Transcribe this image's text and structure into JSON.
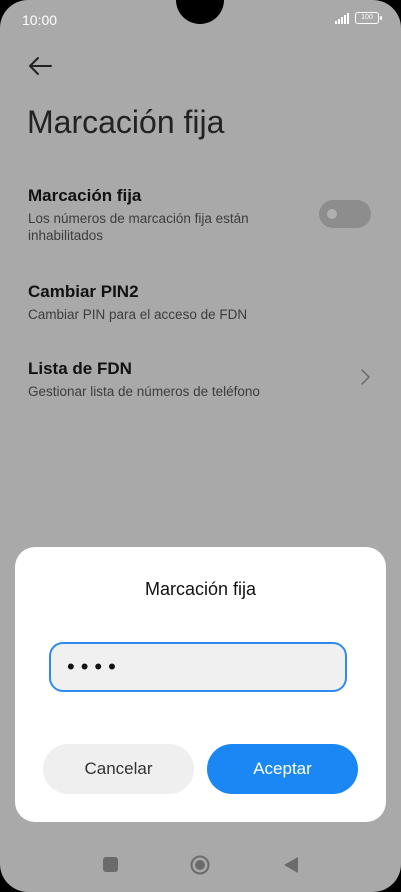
{
  "status_bar": {
    "time": "10:00",
    "battery": "100"
  },
  "header": {
    "title": "Marcación fija"
  },
  "settings": [
    {
      "title": "Marcación fija",
      "subtitle": "Los números de marcación fija están inhabilitados",
      "toggle_on": false
    },
    {
      "title": "Cambiar PIN2",
      "subtitle": "Cambiar PIN para el acceso de FDN"
    },
    {
      "title": "Lista de FDN",
      "subtitle": "Gestionar lista de números de teléfono"
    }
  ],
  "dialog": {
    "title": "Marcación fija",
    "input_value": "••••",
    "cancel_label": "Cancelar",
    "ok_label": "Aceptar"
  },
  "colors": {
    "accent": "#1a87f5",
    "overlay": "#a9a9a9"
  },
  "icons": [
    "back-arrow-icon",
    "chevron-right-icon",
    "signal-icon",
    "battery-icon",
    "recents-icon",
    "home-icon",
    "nav-back-icon"
  ]
}
